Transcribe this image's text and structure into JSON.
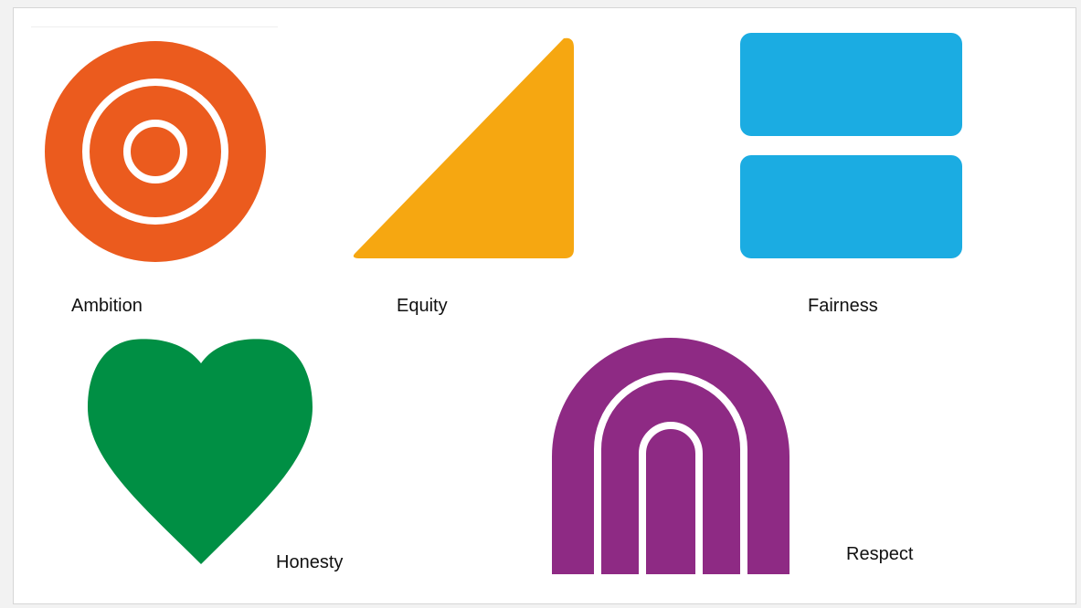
{
  "values": [
    {
      "label": "Ambition",
      "icon": "target-icon",
      "color": "#EB5B1E"
    },
    {
      "label": "Equity",
      "icon": "triangle-icon",
      "color": "#F6A711"
    },
    {
      "label": "Fairness",
      "icon": "stacked-rectangles-icon",
      "color": "#1BACE2"
    },
    {
      "label": "Honesty",
      "icon": "heart-icon",
      "color": "#008F44"
    },
    {
      "label": "Respect",
      "icon": "arch-icon",
      "color": "#8E2A84"
    }
  ]
}
